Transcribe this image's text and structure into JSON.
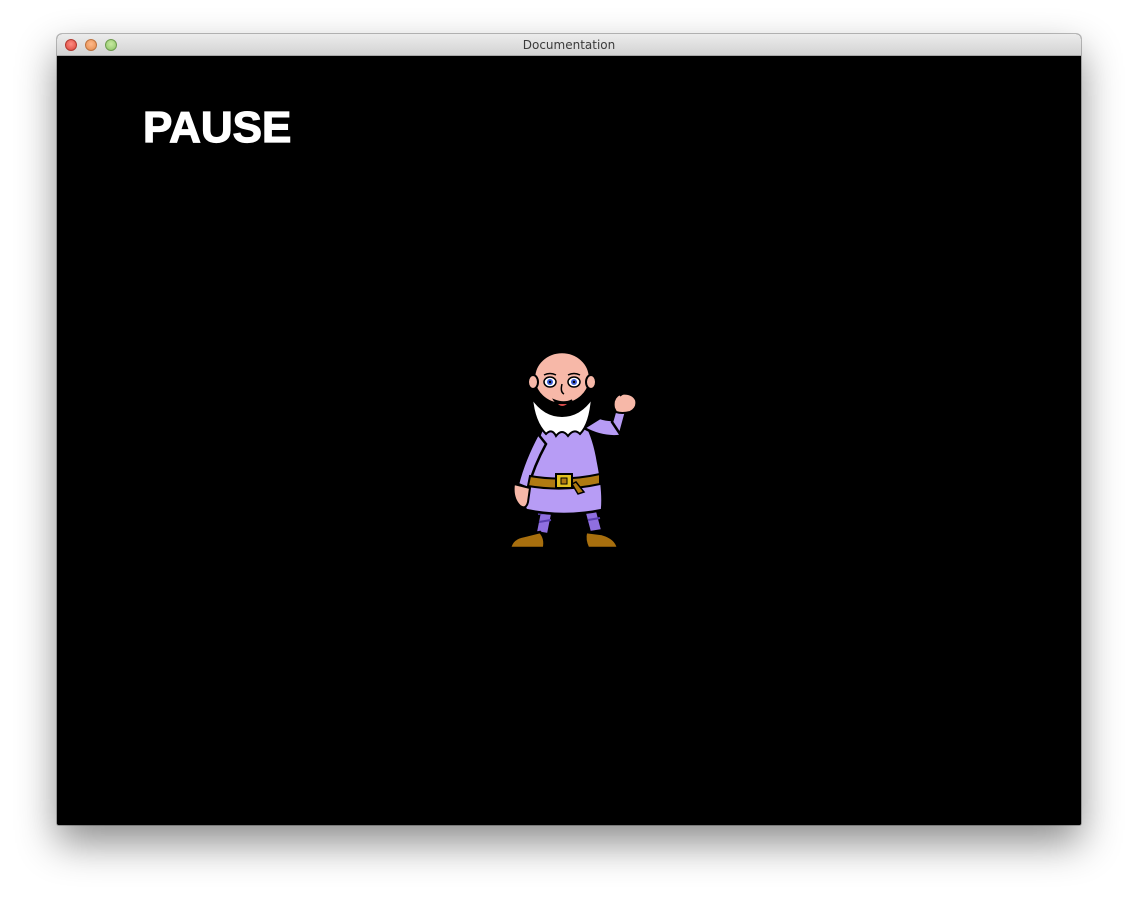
{
  "window": {
    "title": "Documentation"
  },
  "game": {
    "status_text": "PAUSE",
    "background_color": "#000000",
    "text_color": "#ffffff",
    "character": {
      "name": "dwarf-sprite",
      "tunic_color": "#b79cf5",
      "beard_color": "#ffffff",
      "skin_color": "#f7b8a8",
      "boot_color": "#a86f0e"
    }
  }
}
